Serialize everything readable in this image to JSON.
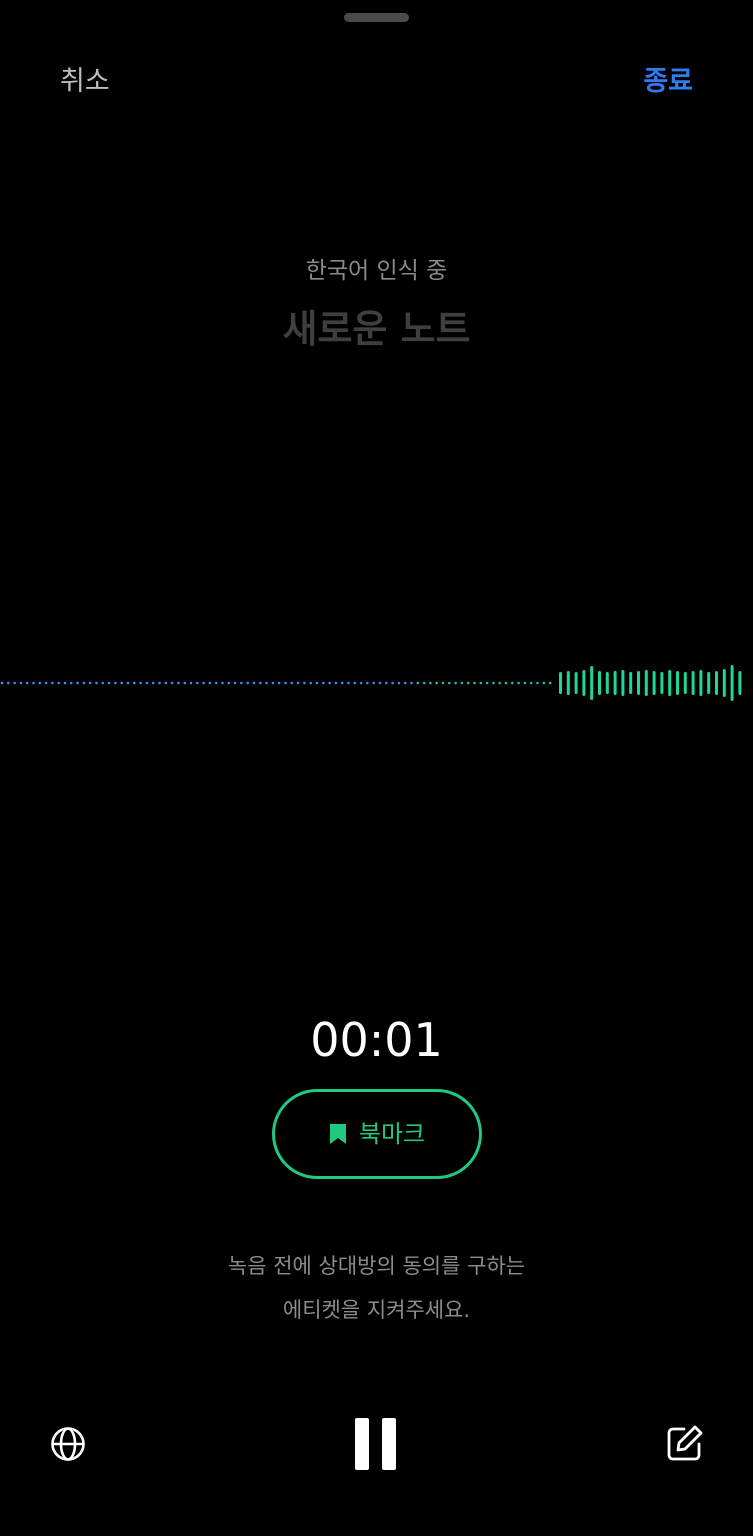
{
  "header": {
    "cancel_label": "취소",
    "finish_label": "종료"
  },
  "recognition": {
    "language_status": "한국어 인식 중",
    "note_title": "새로운 노트"
  },
  "recording": {
    "elapsed_time": "00:01",
    "bookmark_label": "북마크"
  },
  "notice": {
    "line1": "녹음 전에 상대방의 동의를 구하는",
    "line2": "에티켓을 지켜주세요."
  },
  "bottom_bar": {
    "language_icon": "globe-icon",
    "pause_icon": "pause-icon",
    "edit_icon": "edit-icon"
  },
  "colors": {
    "accent_blue": "#2f7bf0",
    "accent_green": "#1fc97f",
    "background": "#000000"
  }
}
